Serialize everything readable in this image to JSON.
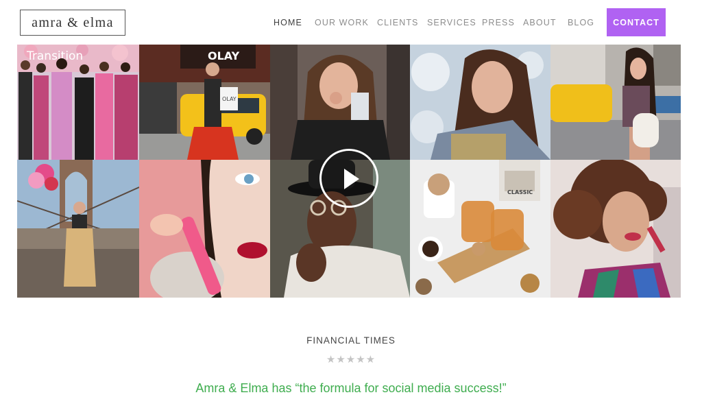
{
  "brand": {
    "logo_text": "amra & elma"
  },
  "nav": {
    "items": [
      {
        "label": "HOME",
        "active": true
      },
      {
        "label": "OUR WORK"
      },
      {
        "label": "CLIENTS"
      },
      {
        "label": "SERVICES"
      },
      {
        "label": "PRESS"
      },
      {
        "label": "ABOUT"
      },
      {
        "label": "BLOG"
      }
    ],
    "contact_label": "CONTACT"
  },
  "gallery": {
    "tiles": [
      {
        "subject": "fashion-runway-group",
        "sign_text": "Transition"
      },
      {
        "subject": "street-style-taxi",
        "store_sign": "OLAY",
        "bag_text": "OLAY"
      },
      {
        "subject": "leather-jacket-snack"
      },
      {
        "subject": "winter-portrait-snow"
      },
      {
        "subject": "city-street-taxi-bag"
      },
      {
        "subject": "brooklyn-bridge-balloons"
      },
      {
        "subject": "lipstick-closeup"
      },
      {
        "subject": "man-hat-video",
        "has_video": true
      },
      {
        "subject": "tea-snacks-table",
        "bottle_text": "CLASSIC"
      },
      {
        "subject": "curly-hair-lipstick"
      }
    ]
  },
  "testimonial": {
    "source": "FINANCIAL TIMES",
    "stars": "★★★★★",
    "quote": "Amra & Elma has “the formula for social media success!”"
  },
  "colors": {
    "accent": "#b062f2",
    "quote_green": "#3fad4f",
    "nav_gray": "#8c8c8c",
    "nav_active": "#3e3e3e"
  }
}
